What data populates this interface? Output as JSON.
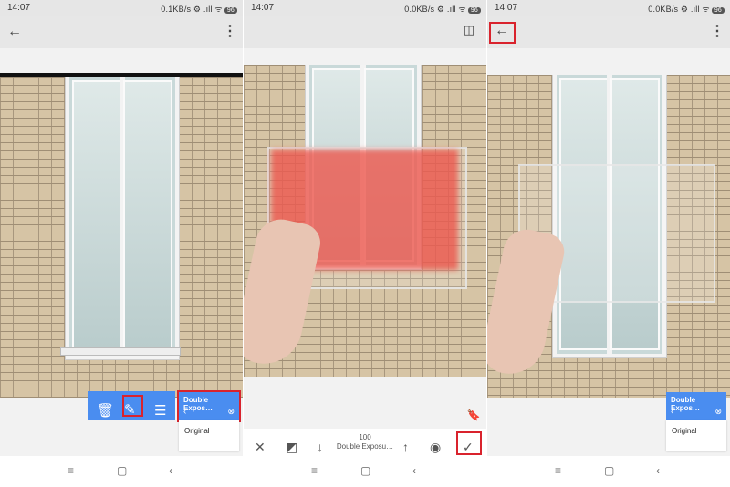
{
  "screens": [
    {
      "status": {
        "time": "14:07",
        "indicators": "0.1KB/s ⚙ .ıll ᯤ",
        "battery": "96"
      },
      "appbar": {
        "back_icon": "arrow-left-icon",
        "menu_icon": "more-vert-icon"
      },
      "toolbar": {
        "delete_icon": "trash-icon",
        "edit_icon": "edit-icon",
        "adjust_icon": "tune-icon"
      },
      "layer_card": {
        "title": "Double Expos…",
        "left_icon": "chevron-left-icon",
        "right_icon": "brush-icon"
      },
      "original_label": "Original"
    },
    {
      "status": {
        "time": "14:07",
        "indicators": "0.0KB/s ⚙ .ıll ᯤ",
        "battery": "96"
      },
      "appbar": {
        "compare_icon": "compare-icon"
      },
      "bookmark_icon": "bookmark-icon",
      "bottom": {
        "value": "100",
        "label": "Double Exposu…",
        "cancel_icon": "close-icon",
        "invert_icon": "invert-icon",
        "down_icon": "arrow-down-icon",
        "up_icon": "arrow-up-icon",
        "view_icon": "eye-icon",
        "apply_icon": "check-icon"
      }
    },
    {
      "status": {
        "time": "14:07",
        "indicators": "0.0KB/s ⚙ .ıll ᯤ",
        "battery": "96"
      },
      "appbar": {
        "back_icon": "arrow-left-icon",
        "menu_icon": "more-vert-icon"
      },
      "layer_card": {
        "title": "Double Expos…",
        "left_icon": "chevron-left-icon",
        "right_icon": "brush-icon"
      },
      "original_label": "Original"
    }
  ],
  "navbar": {
    "menu_icon": "menu-icon",
    "home_icon": "home-icon",
    "back_icon": "nav-back-icon"
  },
  "colors": {
    "accent": "#4a8df0",
    "highlight": "#d9232d",
    "apply": "#1e7fe0"
  }
}
